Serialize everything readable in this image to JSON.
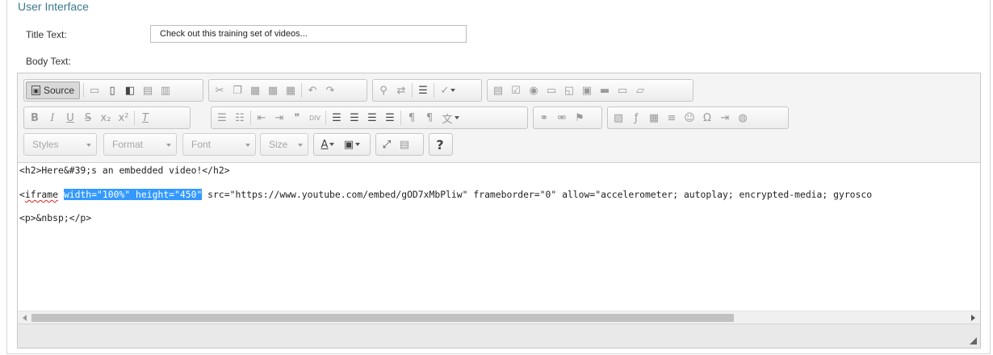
{
  "section": {
    "title": "User Interface"
  },
  "fields": {
    "title_label": "Title Text:",
    "title_value": "Check out this training set of videos...",
    "body_label": "Body Text:"
  },
  "toolbar": {
    "source_label": "Source",
    "source_icon_text": "▣",
    "combos": {
      "styles": "Styles",
      "format": "Format",
      "font": "Font",
      "size": "Size"
    },
    "help_label": "?"
  },
  "code": {
    "line1": "<h2>Here&#39;s an embedded video!</h2>",
    "line2_a": "<",
    "line2_iframe": "iframe",
    "line2_sp": " ",
    "line2_selected": "width=\"100%\" height=\"450\"",
    "line2_b": " src=\"https://www.youtube.com/embed/gOD7xMbPliw\" frameborder=\"0\" allow=\"accelerometer; autoplay; encrypted-media; gyrosco",
    "line3": "<p>&nbsp;</p>"
  },
  "icons": {
    "row1": [
      "save-icon",
      "new-page-icon",
      "preview-icon",
      "print-icon",
      "templates-icon",
      "cut-icon",
      "copy-icon",
      "paste-icon",
      "paste-text-icon",
      "paste-word-icon",
      "undo-icon",
      "redo-icon",
      "find-icon",
      "replace-icon",
      "select-all-icon",
      "spellcheck-icon",
      "form-icon",
      "checkbox-icon",
      "radio-icon",
      "textfield-icon",
      "textarea-icon",
      "select-icon",
      "button-icon",
      "image-button-icon",
      "hidden-field-icon"
    ],
    "row2": [
      "bold-icon",
      "italic-icon",
      "underline-icon",
      "strike-icon",
      "subscript-icon",
      "superscript-icon",
      "remove-format-icon",
      "numbered-list-icon",
      "bulleted-list-icon",
      "outdent-icon",
      "indent-icon",
      "blockquote-icon",
      "div-icon",
      "align-left-icon",
      "align-center-icon",
      "align-right-icon",
      "justify-icon",
      "ltr-icon",
      "rtl-icon",
      "language-icon",
      "link-icon",
      "unlink-icon",
      "anchor-icon",
      "image-icon",
      "flash-icon",
      "table-icon",
      "horizontal-rule-icon",
      "smiley-icon",
      "special-char-icon",
      "page-break-icon",
      "iframe-icon"
    ]
  }
}
